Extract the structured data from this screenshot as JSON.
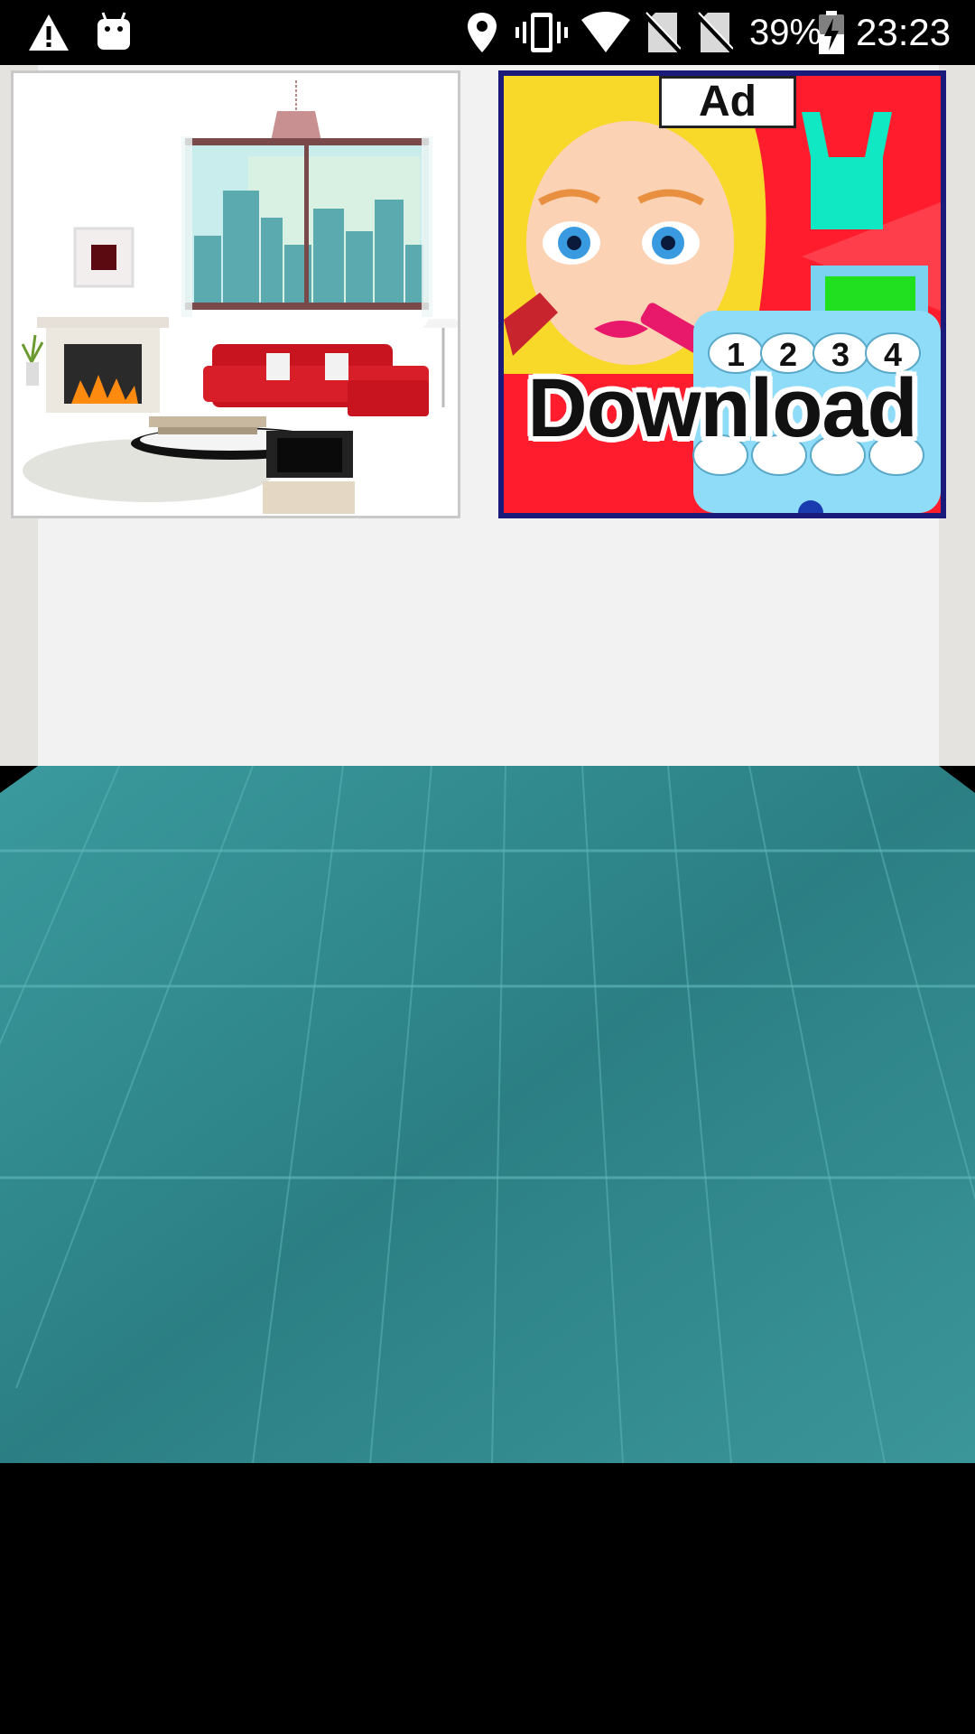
{
  "status_bar": {
    "icons": [
      "warning-icon",
      "android-debug-icon",
      "location-icon",
      "vibrate-icon",
      "wifi-icon",
      "no-sim-icon",
      "no-sim-icon",
      "battery-charging-icon"
    ],
    "battery_percent": "39%",
    "time": "23:23"
  },
  "room": {
    "wall_color": "#f2f2f2",
    "floor_color": "#2f8a8e"
  },
  "thumbnails": {
    "room_preview": {
      "icon": "living-room-thumbnail"
    },
    "ad": {
      "label": "Ad",
      "cta": "Download",
      "keypad": [
        "1",
        "2",
        "3",
        "4"
      ]
    }
  }
}
